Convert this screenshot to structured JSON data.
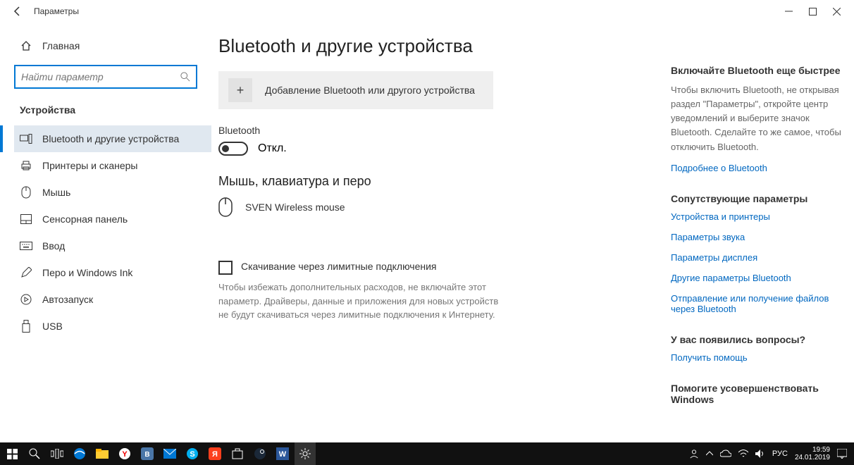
{
  "titlebar": {
    "title": "Параметры"
  },
  "sidebar": {
    "home": "Главная",
    "search_placeholder": "Найти параметр",
    "section": "Устройства",
    "items": [
      "Bluetooth и другие устройства",
      "Принтеры и сканеры",
      "Мышь",
      "Сенсорная панель",
      "Ввод",
      "Перо и Windows Ink",
      "Автозапуск",
      "USB"
    ]
  },
  "main": {
    "heading": "Bluetooth и другие устройства",
    "add_device": "Добавление Bluetooth или другого устройства",
    "bt_label": "Bluetooth",
    "bt_state": "Откл.",
    "mouse_section": "Мышь, клавиатура и перо",
    "device_name": "SVEN Wireless mouse",
    "metered_label": "Скачивание через лимитные подключения",
    "metered_desc": "Чтобы избежать дополнительных расходов, не включайте этот параметр. Драйверы, данные и приложения для новых устройств не будут скачиваться через лимитные подключения к Интернету."
  },
  "right": {
    "tip_title": "Включайте Bluetooth еще быстрее",
    "tip_text": "Чтобы включить Bluetooth, не открывая раздел \"Параметры\", откройте центр уведомлений и выберите значок Bluetooth. Сделайте то же самое, чтобы отключить Bluetooth.",
    "tip_link": "Подробнее о Bluetooth",
    "related_title": "Сопутствующие параметры",
    "related_links": [
      "Устройства и принтеры",
      "Параметры звука",
      "Параметры дисплея",
      "Другие параметры Bluetooth",
      "Отправление или получение файлов через Bluetooth"
    ],
    "help_title": "У вас появились вопросы?",
    "help_link": "Получить помощь",
    "improve_title": "Помогите усовершенствовать Windows"
  },
  "taskbar": {
    "lang": "РУС",
    "time": "19:59",
    "date": "24.01.2019"
  }
}
